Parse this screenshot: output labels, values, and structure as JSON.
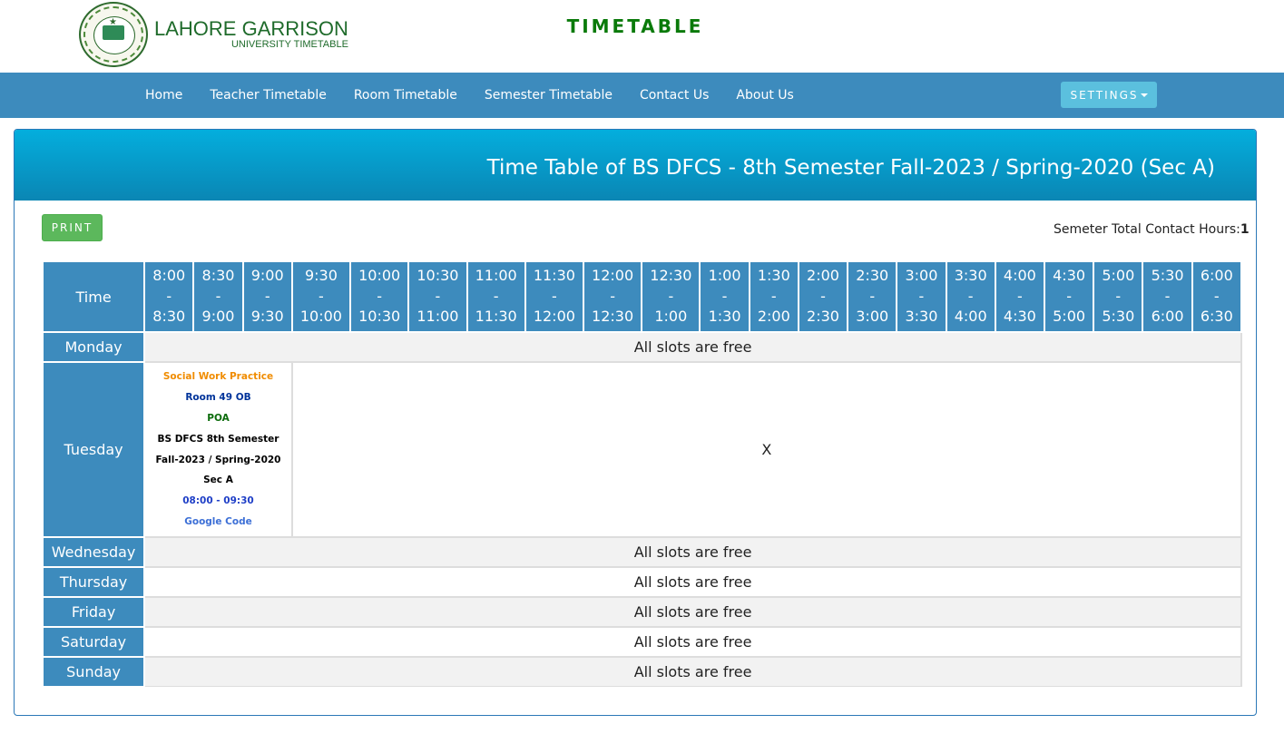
{
  "header": {
    "logo_title": "LAHORE GARRISON",
    "logo_sub": "UNIVERSITY TIMETABLE",
    "page_heading": "TIMETABLE"
  },
  "nav": {
    "items": [
      "Home",
      "Teacher Timetable",
      "Room Timetable",
      "Semester Timetable",
      "Contact Us",
      "About Us"
    ],
    "settings_label": "SETTINGS"
  },
  "panel": {
    "title": "Time Table of BS DFCS - 8th Semester Fall-2023 / Spring-2020 (Sec A)",
    "print_label": "PRINT",
    "contact_label": "Semeter Total Contact Hours:",
    "contact_value": "1"
  },
  "table": {
    "time_header": "Time",
    "slots": [
      [
        "8:00",
        "-",
        "8:30"
      ],
      [
        "8:30",
        "-",
        "9:00"
      ],
      [
        "9:00",
        "-",
        "9:30"
      ],
      [
        "9:30",
        "-",
        "10:00"
      ],
      [
        "10:00",
        "-",
        "10:30"
      ],
      [
        "10:30",
        "-",
        "11:00"
      ],
      [
        "11:00",
        "-",
        "11:30"
      ],
      [
        "11:30",
        "-",
        "12:00"
      ],
      [
        "12:00",
        "-",
        "12:30"
      ],
      [
        "12:30",
        "-",
        "1:00"
      ],
      [
        "1:00",
        "-",
        "1:30"
      ],
      [
        "1:30",
        "-",
        "2:00"
      ],
      [
        "2:00",
        "-",
        "2:30"
      ],
      [
        "2:30",
        "-",
        "3:00"
      ],
      [
        "3:00",
        "-",
        "3:30"
      ],
      [
        "3:30",
        "-",
        "4:00"
      ],
      [
        "4:00",
        "-",
        "4:30"
      ],
      [
        "4:30",
        "-",
        "5:00"
      ],
      [
        "5:00",
        "-",
        "5:30"
      ],
      [
        "5:30",
        "-",
        "6:00"
      ],
      [
        "6:00",
        "-",
        "6:30"
      ]
    ],
    "days": {
      "monday": "Monday",
      "tuesday": "Tuesday",
      "wednesday": "Wednesday",
      "thursday": "Thursday",
      "friday": "Friday",
      "saturday": "Saturday",
      "sunday": "Sunday"
    },
    "free_text": "All slots are free",
    "tuesday_empty": "X",
    "lecture": {
      "subject": "Social Work Practice",
      "room": "Room 49 OB",
      "teacher": "POA",
      "semester": "BS DFCS 8th Semester",
      "session": "Fall-2023 / Spring-2020",
      "section": "Sec A",
      "time": "08:00 - 09:30",
      "code": "Google Code"
    }
  }
}
